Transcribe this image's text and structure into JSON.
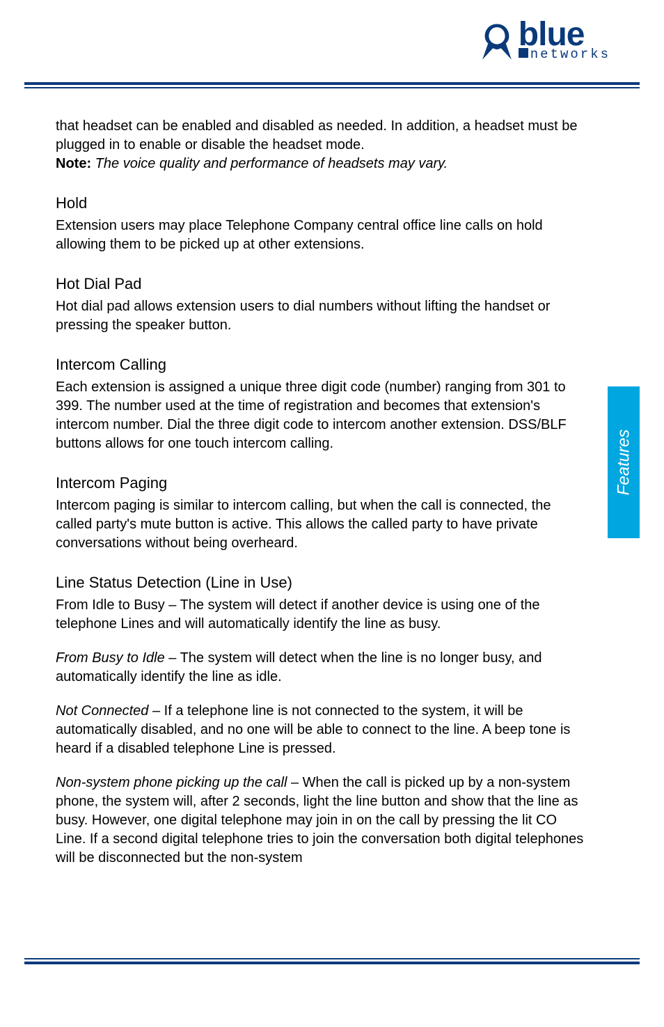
{
  "logo": {
    "word": "blue",
    "sub": "networks"
  },
  "side_tab": "Features",
  "intro": {
    "para": "that headset can be enabled and disabled as needed.  In addition, a headset must be plugged in to enable or disable the headset mode.",
    "note_label": "Note:",
    "note_text": "The voice quality and performance of headsets may vary."
  },
  "sections": {
    "hold": {
      "title": "Hold",
      "body": "Extension users may place Telephone Company central office line calls on hold allowing them to be picked up at other extensions."
    },
    "hot_dial_pad": {
      "title": "Hot Dial Pad",
      "body": "Hot dial pad allows extension users to dial numbers without lifting the handset or pressing the speaker button."
    },
    "intercom_calling": {
      "title": "Intercom Calling",
      "body": "Each extension is assigned a unique three digit code (number) ranging from 301 to 399. The number used at the time of registration and becomes that extension's intercom number.  Dial the three digit code to intercom another extension.  DSS/BLF buttons allows for one touch intercom calling."
    },
    "intercom_paging": {
      "title": "Intercom Paging",
      "body": "Intercom paging is similar to intercom calling, but when the call is connected, the called party's mute button is active.  This allows the called party to have private conversations without being overheard."
    },
    "line_status": {
      "title": "Line Status Detection (Line in Use)",
      "items": [
        {
          "lead": "From Idle to Busy",
          "rest": " – The system will detect if another device is using one of the telephone Lines and will automatically identify the line as busy."
        },
        {
          "lead": "From Busy to Idle",
          "rest": " – The system will detect when the line is no longer busy, and automatically identify the line as idle."
        },
        {
          "lead": "Not Connected",
          "rest": " – If a telephone line is not connected to the system, it will be automatically disabled, and no one will be able to connect to the line. A beep tone is heard if a disabled telephone Line is pressed."
        },
        {
          "lead": "Non-system phone picking up the call",
          "rest": " – When the call is picked up by a non-system phone, the system will, after 2 seconds, light the line button and show that the line as busy.  However, one digital telephone may join in on the call by pressing the lit CO Line.  If a second digital telephone tries to join the conversation both digital telephones will be disconnected but the non-system"
        }
      ]
    }
  }
}
